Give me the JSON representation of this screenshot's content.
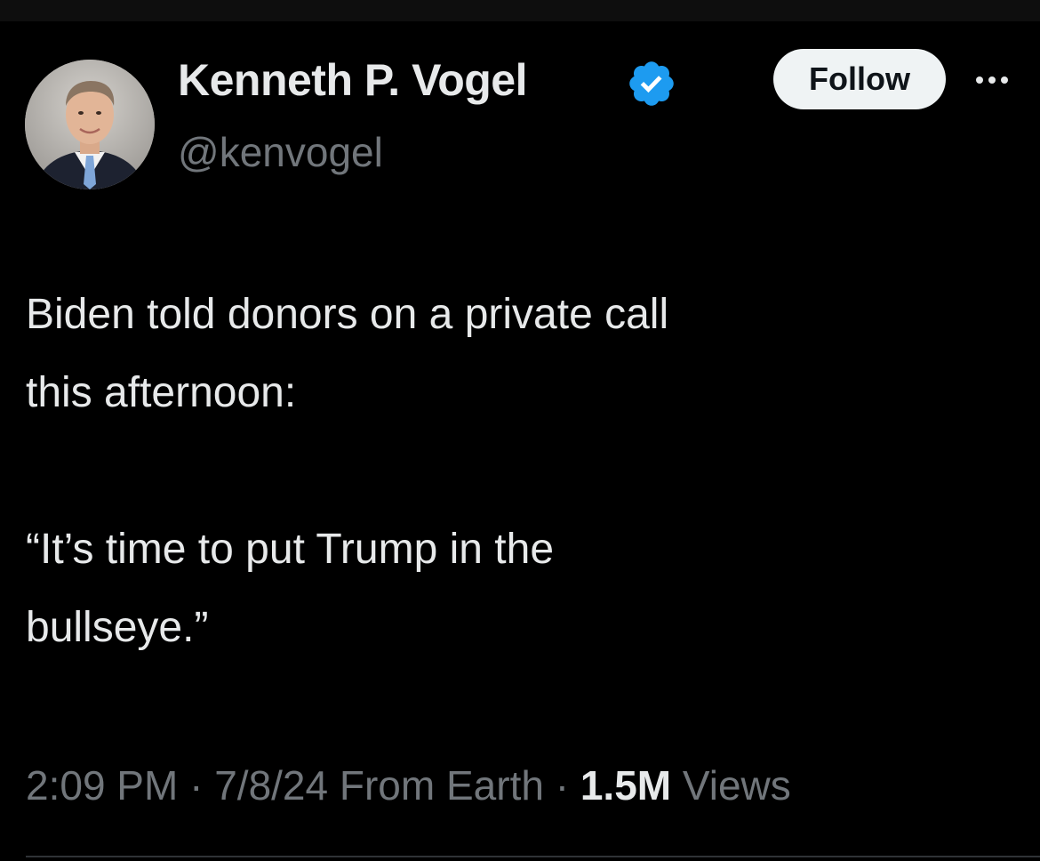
{
  "author": {
    "display_name": "Kenneth P. Vogel",
    "handle": "@kenvogel",
    "verified": true,
    "verified_badge_color": "#1d9bf0"
  },
  "actions": {
    "follow_label": "Follow",
    "more_icon": "more-horizontal-icon"
  },
  "tweet": {
    "line1": "Biden told donors on a private call",
    "line2": "this afternoon:",
    "line3": "“It’s time to put Trump in the",
    "line4": "bullseye.”"
  },
  "meta": {
    "time": "2:09 PM",
    "date": "7/8/24",
    "location": "From Earth",
    "separator": "·",
    "views_count": "1.5M",
    "views_label": "Views"
  },
  "colors": {
    "background": "#000000",
    "text_primary": "#e7e9ea",
    "text_secondary": "#71767b",
    "button_bg": "#eff3f4"
  }
}
